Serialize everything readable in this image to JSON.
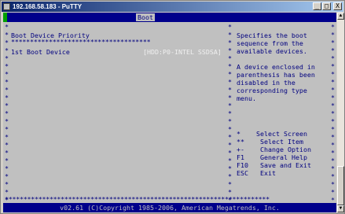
{
  "window": {
    "title": "192.168.58.183 - PuTTY",
    "controls": [
      "_",
      "□",
      "X"
    ]
  },
  "bios": {
    "active_tab": "Boot",
    "section_title": "Boot Device Priority",
    "items": [
      {
        "label": "1st Boot Device",
        "value": "[HDD:P0-INTEL SSDSA]"
      }
    ],
    "help_lines": [
      "Specifies the boot",
      "sequence from the",
      "available devices.",
      "",
      "A device enclosed in",
      "parenthesis has been",
      "disabled in the",
      "corresponding type",
      "menu."
    ],
    "keys": [
      {
        "key": "*",
        "action": "Select Screen"
      },
      {
        "key": "**",
        "action": "Select Item"
      },
      {
        "key": "+-",
        "action": "Change Option"
      },
      {
        "key": "F1",
        "action": "General Help"
      },
      {
        "key": "F10",
        "action": "Save and Exit"
      },
      {
        "key": "ESC",
        "action": "Exit"
      }
    ],
    "footer": "v02.61 (C)Copyright 1985-2006, American Megatrends, Inc."
  }
}
